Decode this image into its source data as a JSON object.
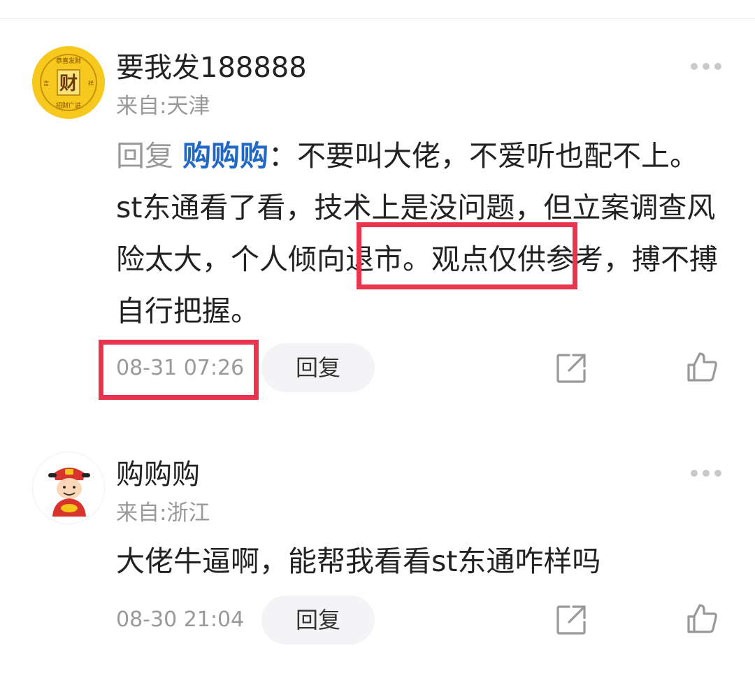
{
  "comments": [
    {
      "username": "要我发188888",
      "location": "来自:天津",
      "reply_prefix": "回复",
      "reply_target": "购购购",
      "reply_colon": "：",
      "text_before_highlight": "不要叫大佬，不爱听也配不上。st东通看了看，技术上是没问题，但立案调查风险太大，",
      "text_highlight": "个人倾向退市",
      "text_after_highlight": "。观点仅供参考，搏不搏自行把握。",
      "timestamp": "08-31 07:26",
      "reply_label": "回复",
      "avatar": {
        "icon": "caishen-coin-icon",
        "glyph": "财",
        "color": "#f5c518"
      }
    },
    {
      "username": "购购购",
      "location": "来自:浙江",
      "text": "大佬牛逼啊，能帮我看看st东通咋样吗",
      "timestamp": "08-30 21:04",
      "reply_label": "回复",
      "avatar": {
        "icon": "god-of-wealth-avatar-icon"
      }
    }
  ],
  "colors": {
    "highlight": "#e8344d",
    "reply_target": "#2167c4",
    "muted": "#999999"
  },
  "icons": [
    "more-icon",
    "share-icon",
    "like-icon"
  ]
}
